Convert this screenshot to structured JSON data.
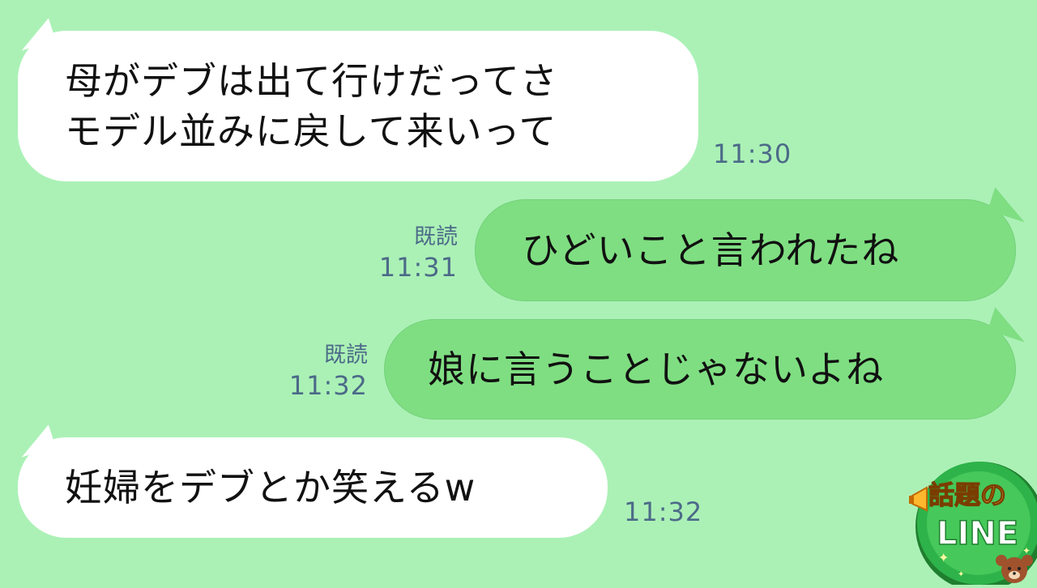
{
  "messages": [
    {
      "side": "in",
      "lines": [
        "母がデブは出て行けだってさ",
        "モデル並みに戻して来いって"
      ],
      "time": "11:30"
    },
    {
      "side": "out",
      "text": "ひどいこと言われたね",
      "read": "既読",
      "time": "11:31"
    },
    {
      "side": "out",
      "text": "娘に言うことじゃないよね",
      "read": "既読",
      "time": "11:32"
    },
    {
      "side": "in",
      "text": "妊婦をデブとか笑えるw",
      "time": "11:32"
    }
  ],
  "logo": {
    "top_text": "話題の",
    "bottom_text": "LINE",
    "icon": "bear-icon",
    "colors": {
      "ring": "#2eb34a",
      "ring_dark": "#1f7f2f",
      "title": "#ffb82e",
      "line_text": "#ffffff"
    }
  },
  "colors": {
    "background": "#abf1b6",
    "incoming_bubble": "#ffffff",
    "outgoing_bubble": "#7fde82",
    "meta_text": "#4c6a88"
  }
}
